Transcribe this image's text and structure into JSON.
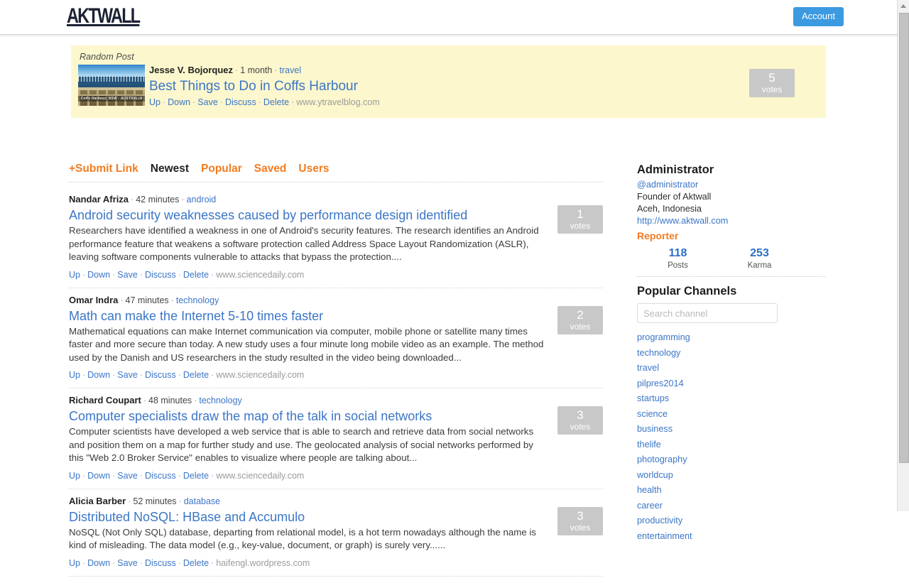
{
  "header": {
    "logo": "AKTWALL",
    "account_label": "Account",
    "accent_blue": "#3c9ae0"
  },
  "random_post": {
    "label": "Random Post",
    "author": "Jesse V. Bojorquez",
    "time": "1 month",
    "channel": "travel",
    "title": "Best Things to Do in Coffs Harbour",
    "actions": [
      "Up",
      "Down",
      "Save",
      "Discuss",
      "Delete"
    ],
    "source": "www.ytravelblog.com",
    "votes": "5",
    "votes_label": "votes",
    "thumb_caption": "Coffs Harbour, NSW - AUSTRALIA",
    "background": "#fcf7cd"
  },
  "tabs": [
    {
      "label": "+Submit Link",
      "active": false
    },
    {
      "label": "Newest",
      "active": true
    },
    {
      "label": "Popular",
      "active": false
    },
    {
      "label": "Saved",
      "active": false
    },
    {
      "label": "Users",
      "active": false
    }
  ],
  "tab_colors": {
    "inactive": "#f47b20",
    "active": "#222222"
  },
  "posts": [
    {
      "author": "Nandar Afriza",
      "time": "42 minutes",
      "channel": "android",
      "title": "Android security weaknesses caused by performance design identified",
      "summary": "Researchers have identified a weakness in one of Android's security features. The research identifies an Android performance feature that weakens a software protection called Address Space Layout Randomization (ASLR), leaving software components vulnerable to attacks that bypass the protection....",
      "actions": [
        "Up",
        "Down",
        "Save",
        "Discuss",
        "Delete"
      ],
      "source": "www.sciencedaily.com",
      "votes": "1",
      "votes_label": "votes"
    },
    {
      "author": "Omar Indra",
      "time": "47 minutes",
      "channel": "technology",
      "title": "Math can make the Internet 5-10 times faster",
      "summary": "Mathematical equations can make Internet communication via computer, mobile phone or satellite many times faster and more secure than today. A new study uses a four minute long mobile video as an example. The method used by the Danish and US researchers in the study resulted in the video being downloaded...",
      "actions": [
        "Up",
        "Down",
        "Save",
        "Discuss",
        "Delete"
      ],
      "source": "www.sciencedaily.com",
      "votes": "2",
      "votes_label": "votes"
    },
    {
      "author": "Richard Coupart",
      "time": "48 minutes",
      "channel": "technology",
      "title": "Computer specialists draw the map of the talk in social networks",
      "summary": "Computer scientists have developed a web service that is able to search and retrieve data from social networks and position them on a map for further study and use. The geolocated analysis of social networks performed by this \"Web 2.0 Broker Service\" enables to visualize where people are talking about...",
      "actions": [
        "Up",
        "Down",
        "Save",
        "Discuss",
        "Delete"
      ],
      "source": "www.sciencedaily.com",
      "votes": "3",
      "votes_label": "votes"
    },
    {
      "author": "Alicia Barber",
      "time": "52 minutes",
      "channel": "database",
      "title": "Distributed NoSQL: HBase and Accumulo",
      "summary": "NoSQL (Not Only SQL) database, departing from relational model,  is a hot term nowadays although the name is kind of misleading. The data model (e.g., key-value, document, or graph) is surely very......",
      "actions": [
        "Up",
        "Down",
        "Save",
        "Discuss",
        "Delete"
      ],
      "source": "haifengl.wordpress.com",
      "votes": "3",
      "votes_label": "votes"
    }
  ],
  "sidebar": {
    "profile": {
      "name": "Administrator",
      "handle": "@administrator",
      "bio": "Founder of Aktwall",
      "location": "Aceh, Indonesia",
      "website": "http://www.aktwall.com",
      "badge": "Reporter",
      "stats": [
        {
          "num": "118",
          "label": "Posts"
        },
        {
          "num": "253",
          "label": "Karma"
        }
      ]
    },
    "channels": {
      "title": "Popular Channels",
      "search_placeholder": "Search channel",
      "search_value": "",
      "items": [
        "programming",
        "technology",
        "travel",
        "pilpres2014",
        "startups",
        "science",
        "business",
        "thelife",
        "photography",
        "worldcup",
        "health",
        "career",
        "productivity",
        "entertainment"
      ]
    }
  }
}
